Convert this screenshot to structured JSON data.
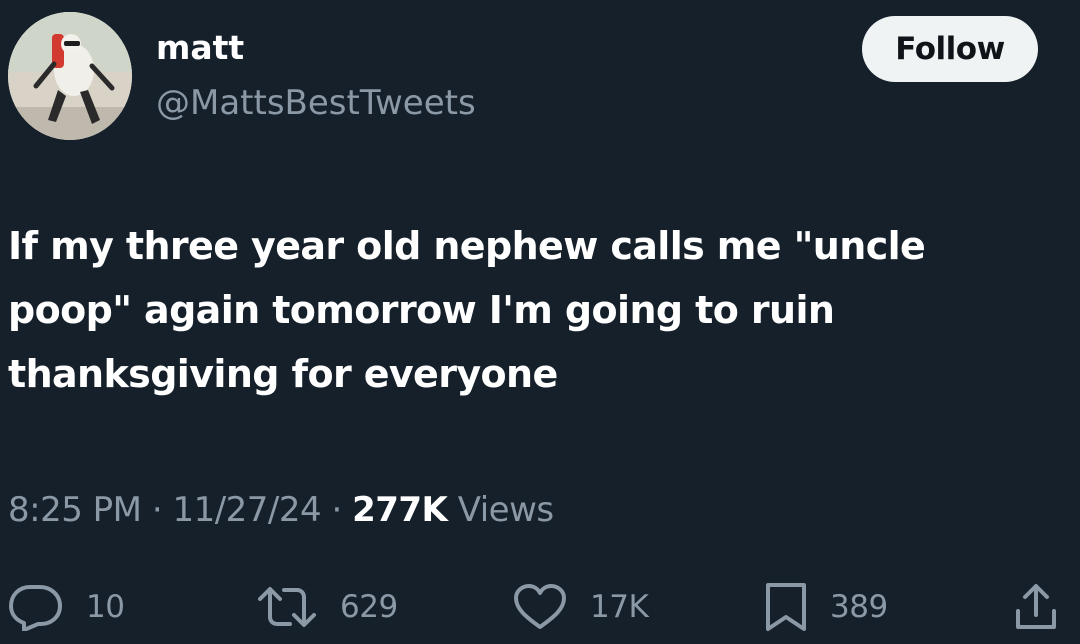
{
  "user": {
    "display_name": "matt",
    "handle": "@MattsBestTweets",
    "avatar_icon": "avatar-photo"
  },
  "follow_label": "Follow",
  "tweet": {
    "text": "If my three year old nephew calls me \"uncle poop\" again tomorrow I'm going to ruin thanksgiving for everyone"
  },
  "meta": {
    "time": "8:25 PM",
    "separator": "·",
    "date": "11/27/24",
    "views_count": "277K",
    "views_label": "Views"
  },
  "actions": {
    "replies": "10",
    "retweets": "629",
    "likes": "17K",
    "bookmarks": "389"
  },
  "colors": {
    "background": "#15202b",
    "muted": "#8b98a5",
    "button_bg": "#eff3f4"
  }
}
